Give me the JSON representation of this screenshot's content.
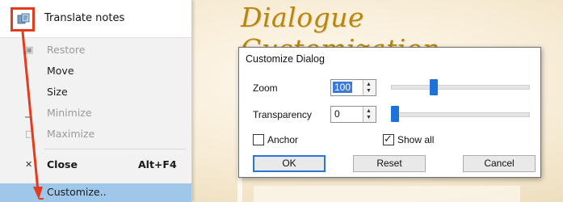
{
  "menu": {
    "title": "Translate notes",
    "items": [
      {
        "label": "Restore",
        "disabled": true,
        "icon": "restore-icon"
      },
      {
        "label": "Move",
        "disabled": false
      },
      {
        "label": "Size",
        "disabled": false
      },
      {
        "label": "Minimize",
        "disabled": true,
        "icon": "minimize-icon"
      },
      {
        "label": "Maximize",
        "disabled": true,
        "icon": "maximize-icon"
      },
      {
        "label": "Close",
        "shortcut": "Alt+F4",
        "icon": "close-icon"
      },
      {
        "label": "Customize..",
        "selected": true
      }
    ]
  },
  "heading": "Dialogue Customization",
  "dialog": {
    "title": "Customize Dialog",
    "zoom_label": "Zoom",
    "zoom_value": "100",
    "zoom_slider_fraction": 0.3,
    "transparency_label": "Transparency",
    "transparency_value": "0",
    "transparency_slider_fraction": 0.0,
    "anchor_label": "Anchor",
    "anchor_checked": false,
    "showall_label": "Show all",
    "showall_checked": true,
    "ok_label": "OK",
    "reset_label": "Reset",
    "cancel_label": "Cancel"
  },
  "colors": {
    "highlight_red": "#e53a1b",
    "selection_blue": "#9fc7ea",
    "slider_blue": "#1e73d8",
    "heading_gold": "#b8860b"
  }
}
